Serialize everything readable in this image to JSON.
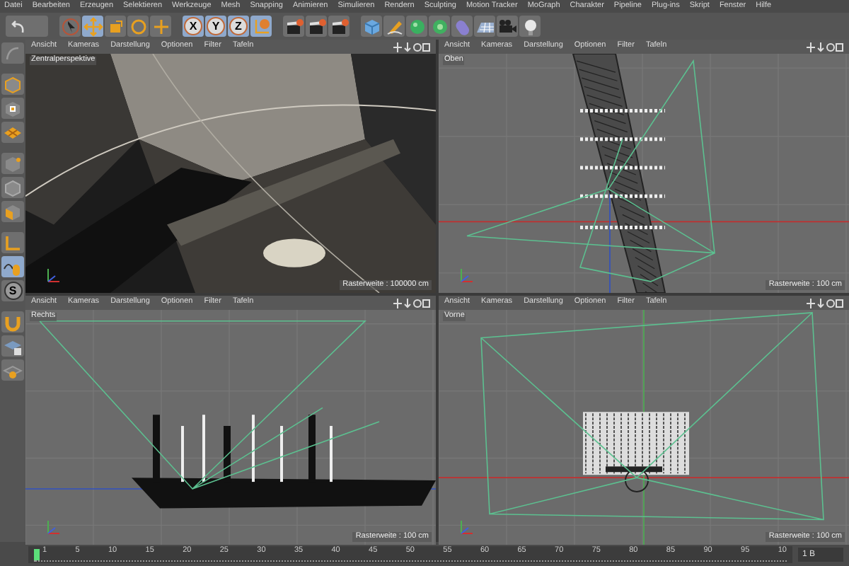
{
  "menu_bar": [
    "Datei",
    "Bearbeiten",
    "Erzeugen",
    "Selektieren",
    "Werkzeuge",
    "Mesh",
    "Snapping",
    "Animieren",
    "Simulieren",
    "Rendern",
    "Sculpting",
    "Motion Tracker",
    "MoGraph",
    "Charakter",
    "Pipeline",
    "Plug-ins",
    "Skript",
    "Fenster",
    "Hilfe"
  ],
  "toolbar": [
    {
      "kind": "undo",
      "selected": false
    },
    {
      "kind": "pointer",
      "selected": false
    },
    {
      "kind": "move",
      "selected": true
    },
    {
      "kind": "scale",
      "selected": false
    },
    {
      "kind": "rotate",
      "selected": false
    },
    {
      "kind": "add",
      "selected": false
    },
    {
      "kind": "axis",
      "label": "X",
      "selected": true
    },
    {
      "kind": "axis",
      "label": "Y",
      "selected": true
    },
    {
      "kind": "axis",
      "label": "Z",
      "selected": true
    },
    {
      "kind": "coords",
      "selected": true
    },
    {
      "kind": "render",
      "selected": false
    },
    {
      "kind": "render",
      "selected": false
    },
    {
      "kind": "render",
      "selected": false
    },
    {
      "kind": "cube",
      "selected": false
    },
    {
      "kind": "pen",
      "selected": false
    },
    {
      "kind": "sphere",
      "selected": false
    },
    {
      "kind": "flower",
      "selected": false
    },
    {
      "kind": "capsule",
      "selected": false
    },
    {
      "kind": "floor",
      "selected": false
    },
    {
      "kind": "camera",
      "selected": false
    },
    {
      "kind": "light",
      "selected": false
    }
  ],
  "left_toolbar": [
    {
      "kind": "editable",
      "selected": false
    },
    {
      "kind": "model",
      "selected": false
    },
    {
      "kind": "texture",
      "selected": false
    },
    {
      "kind": "workplane",
      "selected": false
    },
    {
      "kind": "points",
      "selected": false
    },
    {
      "kind": "edges",
      "selected": false
    },
    {
      "kind": "polygons",
      "selected": false
    },
    {
      "kind": "axis",
      "selected": false
    },
    {
      "kind": "tweak",
      "selected": true
    },
    {
      "kind": "snap",
      "label": "S",
      "selected": false
    },
    {
      "kind": "magnet",
      "selected": false
    },
    {
      "kind": "lock",
      "selected": false
    },
    {
      "kind": "grid",
      "selected": false
    }
  ],
  "viewports": [
    {
      "kind": "render",
      "menu": [
        "Ansicht",
        "Kameras",
        "Darstellung",
        "Optionen",
        "Filter",
        "Tafeln"
      ],
      "label": "Zentralperspektive",
      "grid_readout": "Rasterweite : 100000 cm"
    },
    {
      "kind": "top",
      "menu": [
        "Ansicht",
        "Kameras",
        "Darstellung",
        "Optionen",
        "Filter",
        "Tafeln"
      ],
      "label": "Oben",
      "grid_readout": "Rasterweite : 100 cm"
    },
    {
      "kind": "right",
      "menu": [
        "Ansicht",
        "Kameras",
        "Darstellung",
        "Optionen",
        "Filter",
        "Tafeln"
      ],
      "label": "Rechts",
      "grid_readout": "Rasterweite : 100 cm"
    },
    {
      "kind": "front",
      "menu": [
        "Ansicht",
        "Kameras",
        "Darstellung",
        "Optionen",
        "Filter",
        "Tafeln"
      ],
      "label": "Vorne",
      "grid_readout": "Rasterweite : 100 cm"
    }
  ],
  "timeline": {
    "ticks": [
      "1",
      "5",
      "10",
      "15",
      "20",
      "25",
      "30",
      "35",
      "40",
      "45",
      "50",
      "55",
      "60",
      "65",
      "70",
      "75",
      "80",
      "85",
      "90",
      "95",
      "10"
    ],
    "level": 0,
    "frame_field": "1 B"
  }
}
